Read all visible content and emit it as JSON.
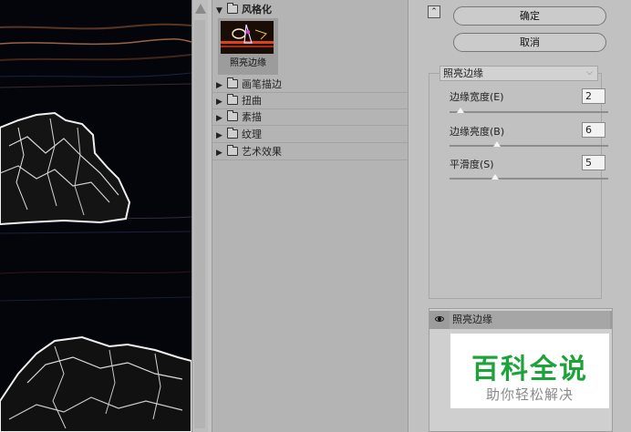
{
  "gallery": {
    "open_category": "风格化",
    "selected_filter_label": "照亮边缘",
    "categories": [
      "画笔描边",
      "扭曲",
      "素描",
      "纹理",
      "艺术效果"
    ]
  },
  "buttons": {
    "ok": "确定",
    "cancel": "取消"
  },
  "settings": {
    "filter_selected": "照亮边缘",
    "params": [
      {
        "label": "边缘宽度(E)",
        "value": "2",
        "slider_fraction": 0.07
      },
      {
        "label": "边缘亮度(B)",
        "value": "6",
        "slider_fraction": 0.3
      },
      {
        "label": "平滑度(S)",
        "value": "5",
        "slider_fraction": 0.29
      }
    ]
  },
  "layers": {
    "active_layer": "照亮边缘"
  },
  "watermark": {
    "title": "百科全说",
    "subtitle": "助你轻松解决"
  },
  "colors": {
    "panel_bg": "#c4c4c4",
    "gallery_bg": "#b4b4b4",
    "watermark_green": "#1ea33a"
  }
}
